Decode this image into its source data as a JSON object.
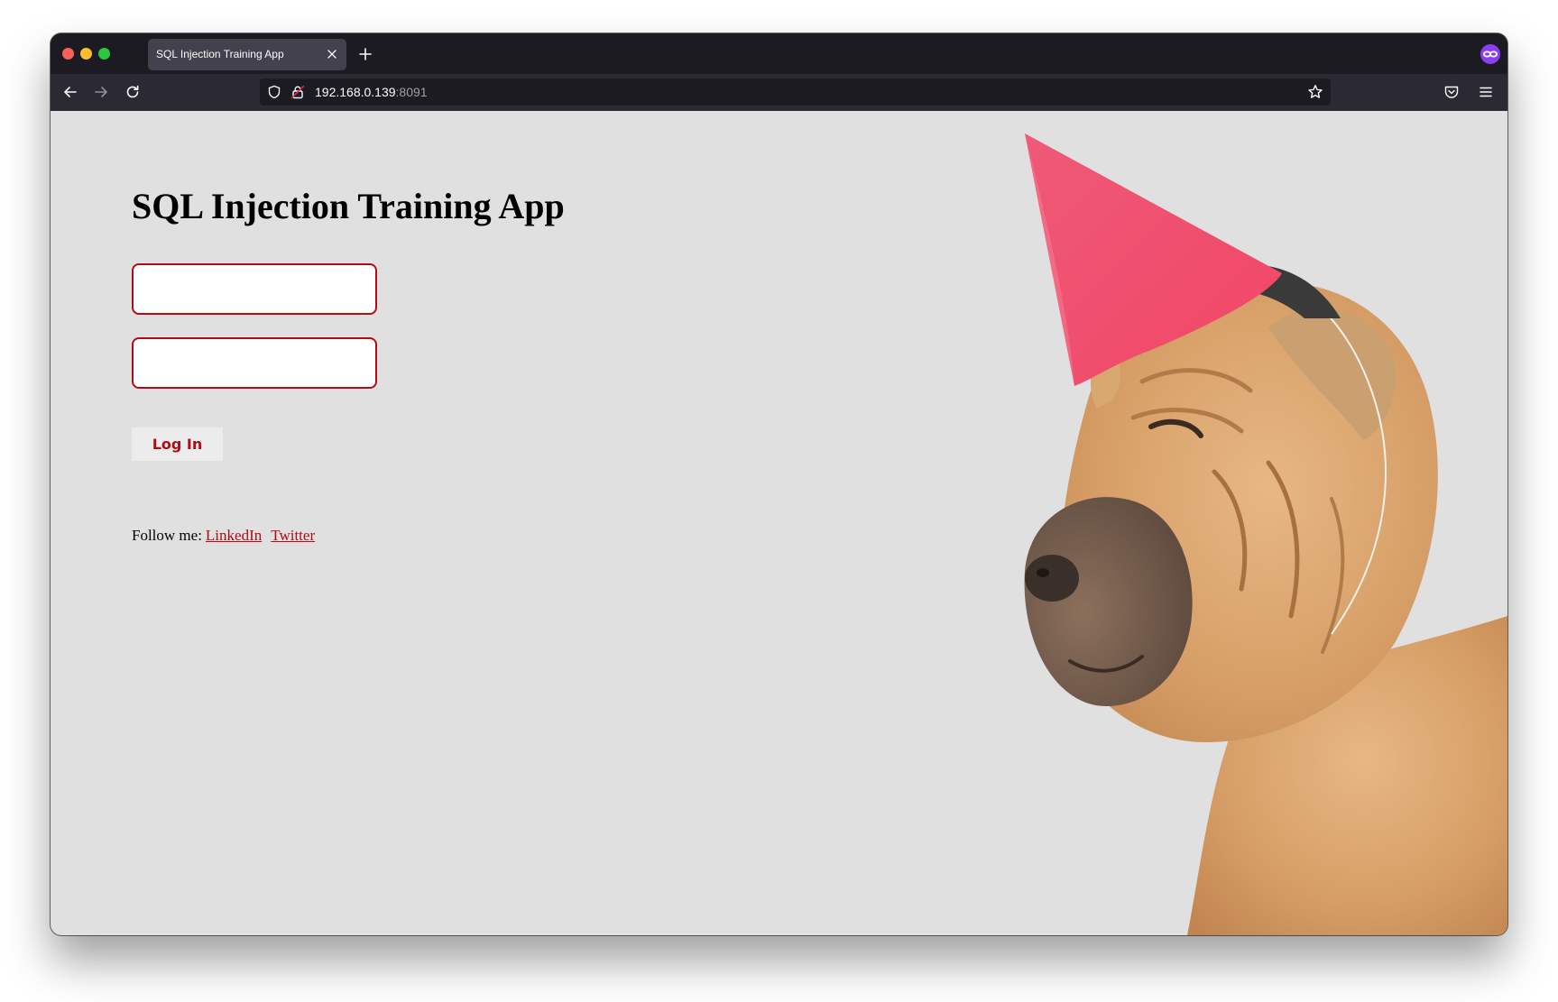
{
  "browser": {
    "tab_title": "SQL Injection Training App",
    "url_host": "192.168.0.139",
    "url_port": ":8091"
  },
  "page": {
    "title": "SQL Injection Training App",
    "username_value": "",
    "password_value": "",
    "login_label": "Log In",
    "follow_label": "Follow me:",
    "links": [
      "LinkedIn",
      "Twitter"
    ]
  },
  "colors": {
    "accent": "#b30b15",
    "page_background": "#e0e0e0",
    "browser_chrome": "#1c1b22",
    "toolbar": "#2b2a33",
    "party_hat": "#f0506e",
    "dog": "#d9a46e"
  },
  "icons": {
    "tab_close": "close-icon",
    "new_tab": "plus-icon",
    "private": "private-browsing-icon",
    "back": "arrow-left-icon",
    "forward": "arrow-right-icon",
    "reload": "reload-icon",
    "tracking": "shield-icon",
    "lock": "lock-icon",
    "bookmark": "star-icon",
    "pocket": "pocket-icon",
    "menu": "hamburger-menu-icon"
  }
}
